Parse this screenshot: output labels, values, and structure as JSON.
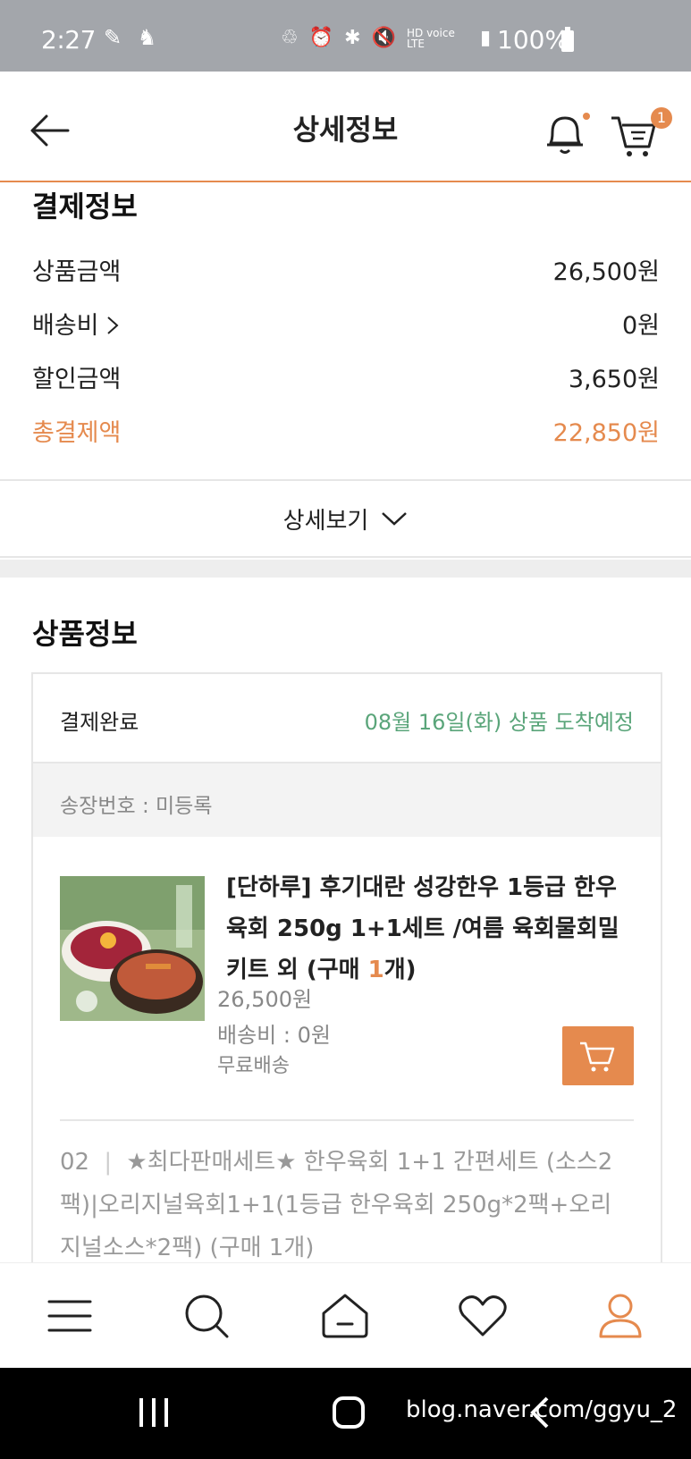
{
  "status_bar": {
    "time": "2:27",
    "network": "HD voice LTE",
    "battery": "100%"
  },
  "header": {
    "title": "상세정보",
    "cart_count": "1"
  },
  "payment": {
    "title": "결제정보",
    "rows": [
      {
        "label": "상품금액",
        "value": "26,500원"
      },
      {
        "label": "배송비 ",
        "value": "0원"
      },
      {
        "label": "할인금액",
        "value": "3,650원"
      },
      {
        "label": "총결제액",
        "value": "22,850원"
      }
    ],
    "detail_label": "상세보기"
  },
  "product_info": {
    "title": "상품정보",
    "status": "결제완료",
    "arrival": "08월 16일(화) 상품 도착예정",
    "invoice": "송장번호 : 미등록",
    "item": {
      "name_prefix": "[단하루] 후기대란 성강한우 1등급 한우육회 250g 1+1세트 /여름 육회물회밀키트 외 (구매 ",
      "qty": "1",
      "name_suffix": "개)",
      "price": "26,500원",
      "shipping": "배송비 : 0원",
      "shipping_note": "무료배송"
    },
    "item2": {
      "index": "02",
      "text": "★최다판매세트★ 한우육회 1+1 간편세트 (소스2팩)|오리지널육회1+1(1등급 한우육회 250g*2팩+오리지널소스*2팩) (구매 1개)"
    }
  },
  "bottom_nav": {
    "items": [
      "menu-icon",
      "search-icon",
      "home-icon",
      "heart-icon",
      "user-icon"
    ],
    "active_color": "#e58a4e"
  },
  "android_nav": {
    "watermark": "blog.naver.com/ggyu_2"
  },
  "colors": {
    "accent": "#e58a4e",
    "green": "#5aa57a",
    "statusbar": "#a3a6ab"
  }
}
